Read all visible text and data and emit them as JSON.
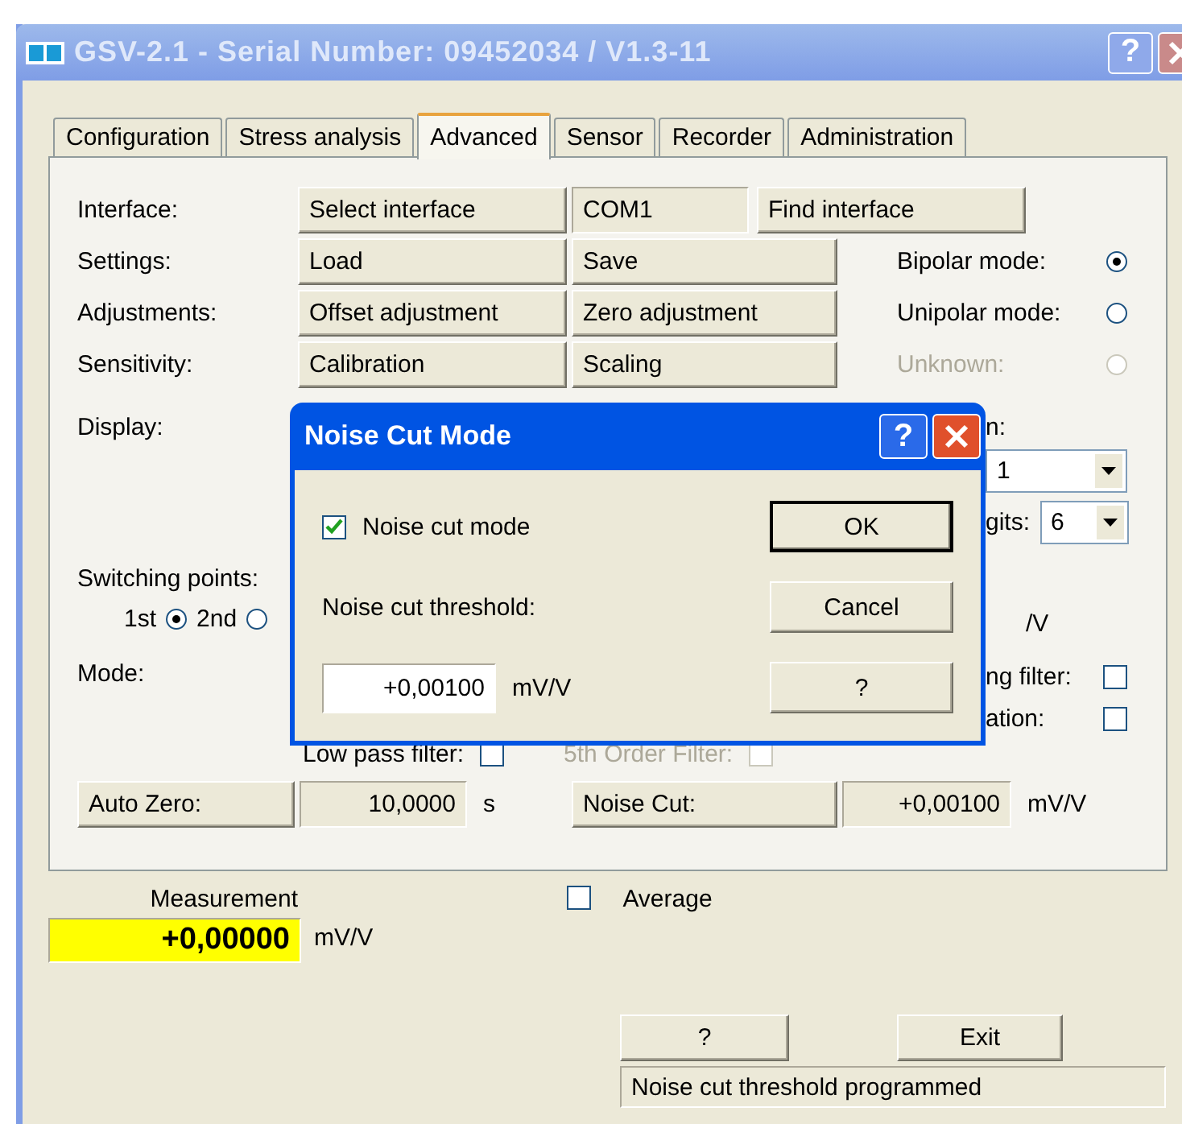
{
  "window": {
    "title": "GSV-2.1 - Serial Number: 09452034 / V1.3-11",
    "help": "?"
  },
  "tabs": [
    {
      "label": "Configuration",
      "selected": false
    },
    {
      "label": "Stress analysis",
      "selected": false
    },
    {
      "label": "Advanced",
      "selected": true
    },
    {
      "label": "Sensor",
      "selected": false
    },
    {
      "label": "Recorder",
      "selected": false
    },
    {
      "label": "Administration",
      "selected": false
    }
  ],
  "advanced": {
    "interface": {
      "label": "Interface:",
      "select_button": "Select interface",
      "port": "COM1",
      "find_button": "Find interface"
    },
    "rows": [
      {
        "label": "Settings:",
        "buttons": [
          "Load",
          "Save"
        ]
      },
      {
        "label": "Adjustments:",
        "buttons": [
          "Offset adjustment",
          "Zero adjustment"
        ]
      },
      {
        "label": "Sensitivity:",
        "buttons": [
          "Calibration",
          "Scaling"
        ]
      }
    ],
    "modes": [
      {
        "label": "Bipolar mode:",
        "selected": true,
        "disabled": false
      },
      {
        "label": "Unipolar mode:",
        "selected": false,
        "disabled": false
      },
      {
        "label": "Unknown:",
        "selected": false,
        "disabled": true
      }
    ],
    "display": {
      "label": "Display:"
    },
    "right_top": {
      "label": "n:",
      "value": "1"
    },
    "right_digits": {
      "label": "gits:",
      "value": "6"
    },
    "switching_points": {
      "label": "Switching points:",
      "options": [
        {
          "label": "1st",
          "selected": true
        },
        {
          "label": "2nd",
          "selected": false
        }
      ]
    },
    "unit_partial": "/V",
    "mode": {
      "label": "Mode:"
    },
    "right_checks": [
      {
        "label": "ng filter:",
        "checked": false
      },
      {
        "label": "ation:",
        "checked": false
      }
    ],
    "filters": [
      {
        "label": "Low pass filter:",
        "checked": false,
        "disabled": false
      },
      {
        "label": "5th Order Filter:",
        "checked": false,
        "disabled": true
      }
    ],
    "auto_zero": {
      "button": "Auto Zero:",
      "value": "10,0000",
      "unit": "s"
    },
    "noise_cut": {
      "button": "Noise Cut:",
      "value": "+0,00100",
      "unit": "mV/V"
    }
  },
  "measurement": {
    "label": "Measurement",
    "value": "+0,00000",
    "unit": "mV/V"
  },
  "average": {
    "label": "Average",
    "checked": false
  },
  "buttons": [
    "?",
    "Exit"
  ],
  "status": "Noise cut threshold programmed",
  "dialog": {
    "title": "Noise Cut Mode",
    "help": "?",
    "noise_cut_mode": {
      "label": "Noise cut mode",
      "checked": true
    },
    "threshold_label": "Noise cut threshold:",
    "threshold_value": "+0,00100",
    "threshold_unit": "mV/V",
    "buttons": [
      "OK",
      "Cancel",
      "?"
    ]
  }
}
